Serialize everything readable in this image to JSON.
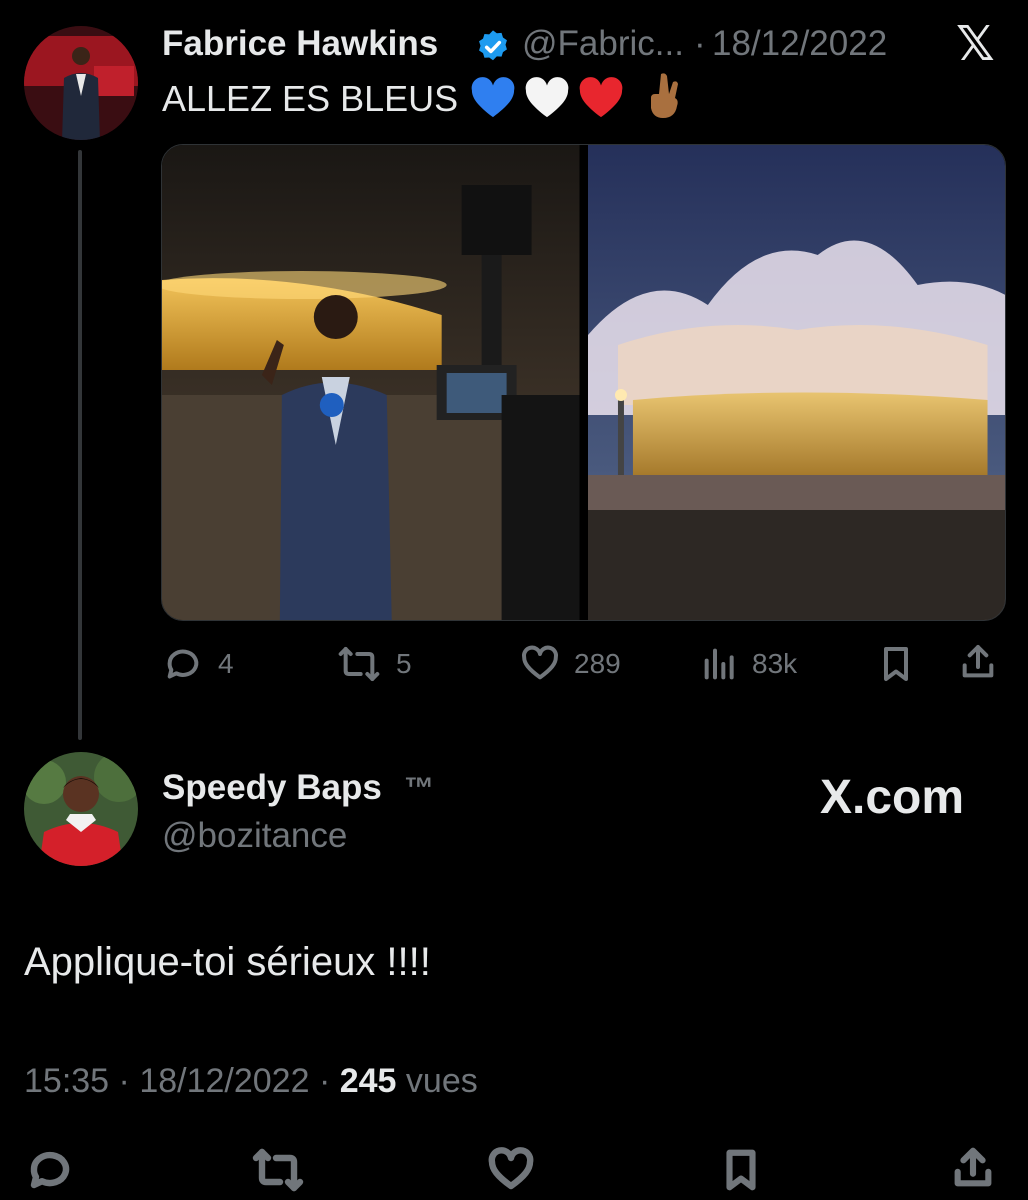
{
  "quoted_tweet": {
    "author_name": "Fabrice Hawkins",
    "handle": "@Fabric...",
    "separator": "·",
    "date": "18/12/2022",
    "text": "ALLEZ ES BLEUS",
    "emojis": [
      "blue-heart",
      "white-heart",
      "red-heart",
      "crossed-fingers"
    ],
    "verified": true,
    "stats": {
      "replies": "4",
      "reposts": "5",
      "likes": "289",
      "views": "83k"
    }
  },
  "reply_tweet": {
    "author_name": "Speedy Baps",
    "trademark": "™",
    "handle": "@bozitance",
    "text": "Applique-toi sérieux !!!!",
    "time": "15:35",
    "sep1": "·",
    "date": "18/12/2022",
    "sep2": "·",
    "views_count": "245",
    "views_label": "vues"
  },
  "branding": {
    "x_logo": "𝕏",
    "site": "X.com"
  },
  "colors": {
    "background": "#000000",
    "text": "#e7e9ea",
    "muted": "#71767b",
    "verified": "#1d9bf0"
  }
}
